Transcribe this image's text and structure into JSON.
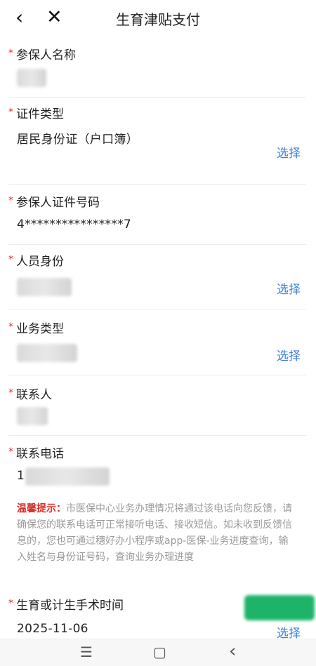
{
  "header": {
    "back_icon": "‹",
    "close_icon": "✕",
    "title": "生育津贴支付"
  },
  "required_mark": "*",
  "fields": {
    "insured_name": {
      "label": "参保人名称"
    },
    "id_type": {
      "label": "证件类型",
      "value": "居民身份证（户口簿）",
      "action": "选择"
    },
    "id_number": {
      "label": "参保人证件号码",
      "value": "4****************7"
    },
    "identity": {
      "label": "人员身份",
      "action": "选择"
    },
    "business_type": {
      "label": "业务类型",
      "action": "选择"
    },
    "contact": {
      "label": "联系人"
    },
    "phone": {
      "label": "联系电话",
      "value_prefix": "1"
    },
    "surgery_time": {
      "label": "生育或计生手术时间",
      "value": "2025-11-06",
      "action": "选择"
    }
  },
  "tip": {
    "title": "温馨提示：",
    "text": "市医保中心业务办理情况将通过该电话向您反馈，请确保您的联系电话可正常接听电话、接收短信。如未收到反馈信息的，您也可通过穗好办小程序或app-医保-业务进度查询，输入姓名与身份证号码，查询业务办理进度"
  },
  "navbar": {
    "menu_icon": "☰",
    "home_icon": "▢",
    "back_icon": "‹"
  },
  "colors": {
    "required": "#d9302c",
    "link": "#3b7fd4",
    "tip_title": "#d9302c",
    "fab": "#1db46a"
  }
}
